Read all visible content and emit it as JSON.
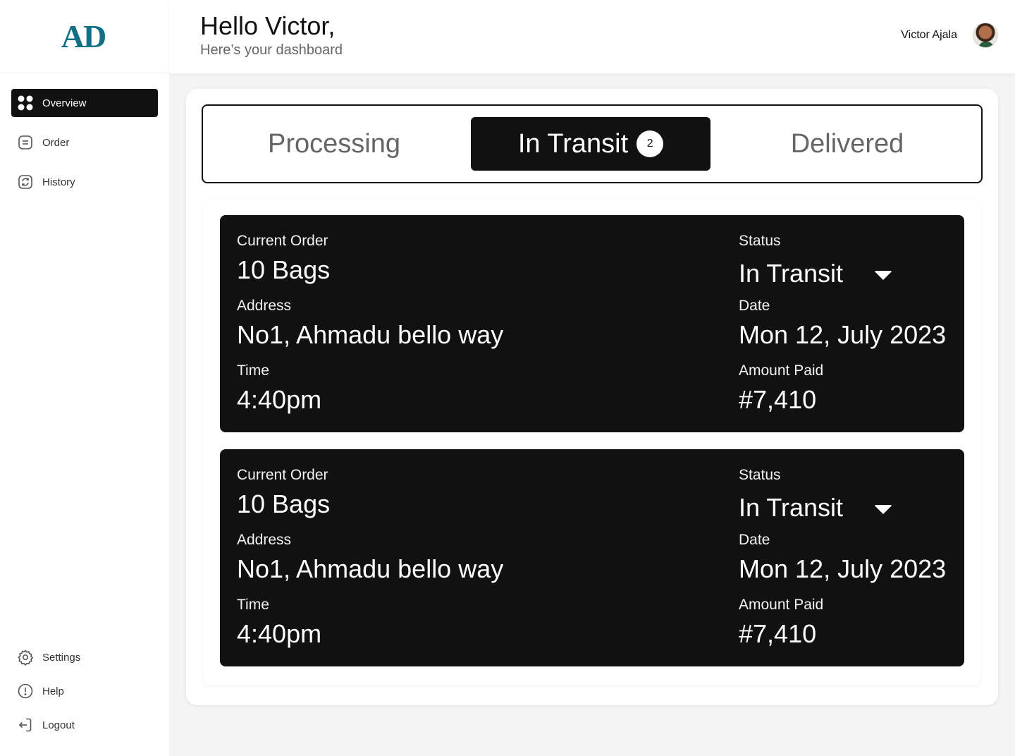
{
  "brand": {
    "logo": "AD",
    "accent": "#136f86"
  },
  "sidebar": {
    "items": [
      {
        "label": "Overview",
        "icon": "grid-icon",
        "active": true
      },
      {
        "label": "Order",
        "icon": "order-icon"
      },
      {
        "label": "History",
        "icon": "history-icon"
      }
    ],
    "bottom": [
      {
        "label": "Settings",
        "icon": "gear-icon"
      },
      {
        "label": "Help",
        "icon": "info-icon"
      },
      {
        "label": "Logout",
        "icon": "logout-icon"
      }
    ]
  },
  "header": {
    "greeting": "Hello Victor,",
    "subtitle": "Here’s your dashboard",
    "user_name": "Victor Ajala"
  },
  "tabs": [
    {
      "label": "Processing"
    },
    {
      "label": "In Transit",
      "count": "2",
      "active": true
    },
    {
      "label": "Delivered"
    }
  ],
  "orders": [
    {
      "order_label": "Current Order",
      "order_value": "10 Bags",
      "address_label": "Address",
      "address_value": "No1, Ahmadu bello way",
      "time_label": "Time",
      "time_value": "4:40pm",
      "status_label": "Status",
      "status_value": "In Transit",
      "date_label": "Date",
      "date_value": "Mon 12, July 2023",
      "amount_label": "Amount Paid",
      "amount_value": "#7,410"
    },
    {
      "order_label": "Current Order",
      "order_value": "10 Bags",
      "address_label": "Address",
      "address_value": "No1, Ahmadu bello way",
      "time_label": "Time",
      "time_value": "4:40pm",
      "status_label": "Status",
      "status_value": "In Transit",
      "date_label": "Date",
      "date_value": "Mon 12, July 2023",
      "amount_label": "Amount Paid",
      "amount_value": "#7,410"
    }
  ]
}
